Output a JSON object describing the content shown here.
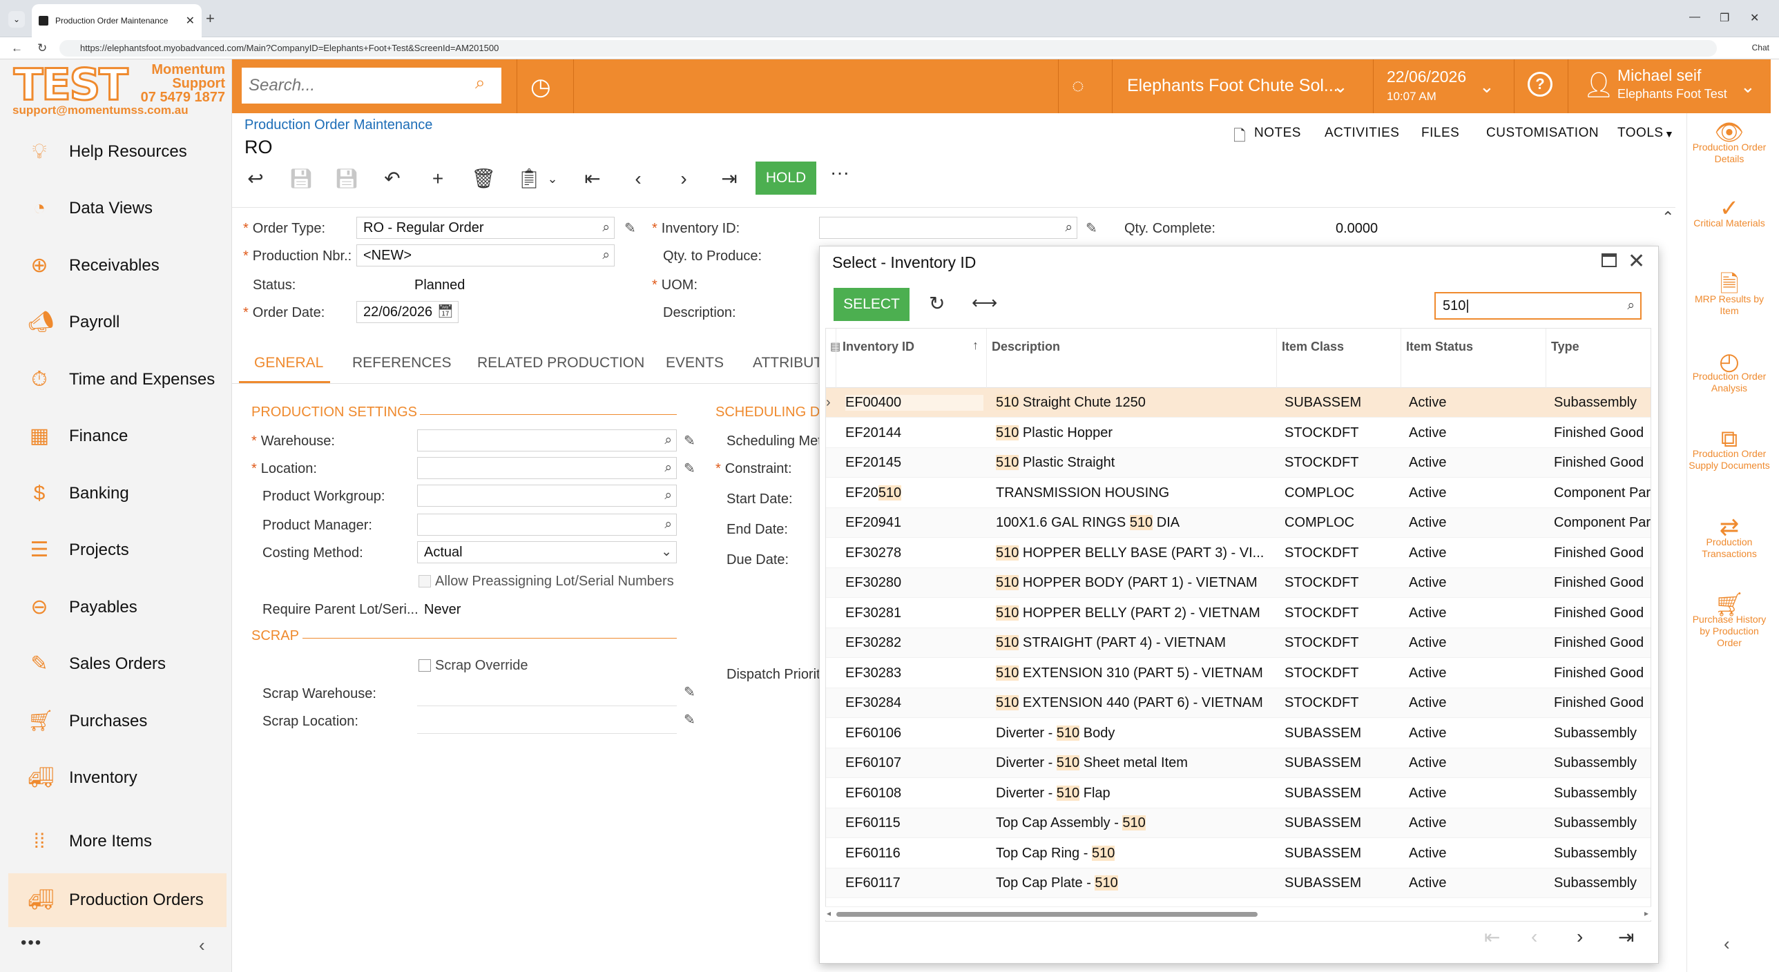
{
  "browser": {
    "tab_title": "Production Order Maintenance",
    "url": "https://elephantsfoot.myobadvanced.com/Main?CompanyID=Elephants+Foot+Test&ScreenId=AM201500",
    "chat_label": "Chat"
  },
  "logo": {
    "brand": "TEST",
    "line1": "Momentum",
    "line2": "Support",
    "line3": "07 5479 1877",
    "line4": "support@momentumss.com.au"
  },
  "sidebar": {
    "items": [
      {
        "label": "Help Resources",
        "icon": "lightbulb-icon"
      },
      {
        "label": "Data Views",
        "icon": "pie-chart-icon"
      },
      {
        "label": "Receivables",
        "icon": "plus-circle-icon"
      },
      {
        "label": "Payroll",
        "icon": "megaphone-icon"
      },
      {
        "label": "Time and Expenses",
        "icon": "stopwatch-icon"
      },
      {
        "label": "Finance",
        "icon": "calculator-icon"
      },
      {
        "label": "Banking",
        "icon": "dollar-icon"
      },
      {
        "label": "Projects",
        "icon": "projects-icon"
      },
      {
        "label": "Payables",
        "icon": "minus-circle-icon"
      },
      {
        "label": "Sales Orders",
        "icon": "edit-icon"
      },
      {
        "label": "Purchases",
        "icon": "cart-icon"
      },
      {
        "label": "Inventory",
        "icon": "truck-icon"
      },
      {
        "label": "More Items",
        "icon": "grid-dots-icon"
      },
      {
        "label": "Production Orders",
        "icon": "truck-icon"
      }
    ],
    "more": "•••"
  },
  "topbar": {
    "search_placeholder": "Search...",
    "company": "Elephants Foot Chute Sol...",
    "date": "22/06/2026",
    "time": "10:07 AM",
    "user_name": "Michael seif",
    "user_company": "Elephants Foot Test"
  },
  "page": {
    "breadcrumb": "Production Order Maintenance",
    "title": "RO",
    "hold_label": "HOLD",
    "more": "···",
    "links": {
      "notes": "NOTES",
      "activities": "ACTIVITIES",
      "files": "FILES",
      "customisation": "CUSTOMISATION",
      "tools": "TOOLS"
    }
  },
  "form": {
    "order_type_label": "Order Type:",
    "order_type": "RO - Regular Order",
    "production_nbr_label": "Production Nbr.:",
    "production_nbr": "<NEW>",
    "status_label": "Status:",
    "status": "Planned",
    "order_date_label": "Order Date:",
    "order_date": "22/06/2026",
    "inventory_id_label": "Inventory ID:",
    "qty_to_produce_label": "Qty. to Produce:",
    "uom_label": "UOM:",
    "description_label": "Description:",
    "qty_complete_label": "Qty. Complete:",
    "qty_complete": "0.0000"
  },
  "tabs": [
    "GENERAL",
    "REFERENCES",
    "RELATED PRODUCTION",
    "EVENTS",
    "ATTRIBUT"
  ],
  "general": {
    "production_settings": "PRODUCTION SETTINGS",
    "warehouse_label": "Warehouse:",
    "location_label": "Location:",
    "product_workgroup_label": "Product Workgroup:",
    "product_manager_label": "Product Manager:",
    "costing_method_label": "Costing Method:",
    "costing_method": "Actual",
    "allow_preassign_label": "Allow Preassigning Lot/Serial Numbers",
    "require_parent_label": "Require Parent Lot/Seri...",
    "require_parent": "Never",
    "scrap": "SCRAP",
    "scrap_override_label": "Scrap Override",
    "scrap_warehouse_label": "Scrap Warehouse:",
    "scrap_location_label": "Scrap Location:",
    "scheduling": "SCHEDULING D",
    "scheduling_method_label": "Scheduling Met",
    "constraint_label": "Constraint:",
    "start_date_label": "Start Date:",
    "end_date_label": "End Date:",
    "due_date_label": "Due Date:",
    "dispatch_priority_label": "Dispatch Priorit"
  },
  "right_panel": [
    {
      "label": "Production Order Details",
      "icon": "eye-icon"
    },
    {
      "label": "Critical Materials",
      "icon": "check-circle-icon"
    },
    {
      "label": "MRP Results by Item",
      "icon": "document-icon"
    },
    {
      "label": "Production Order Analysis",
      "icon": "gauge-icon"
    },
    {
      "label": "Production Order Supply Documents",
      "icon": "hierarchy-icon"
    },
    {
      "label": "Production Transactions",
      "icon": "swap-arrows-icon"
    },
    {
      "label": "Purchase History by Production Order",
      "icon": "cart-icon"
    }
  ],
  "dialog": {
    "title": "Select - Inventory ID",
    "select_label": "SELECT",
    "search_value": "510",
    "columns": [
      "Inventory ID",
      "Description",
      "Item Class",
      "Item Status",
      "Type"
    ],
    "rows": [
      {
        "id": "EF00400",
        "desc": "510 Straight Chute 1250",
        "cls": "SUBASSEM",
        "status": "Active",
        "type": "Subassembly"
      },
      {
        "id": "EF20144",
        "desc": "510 Plastic Hopper",
        "cls": "STOCKDFT",
        "status": "Active",
        "type": "Finished Good"
      },
      {
        "id": "EF20145",
        "desc": "510 Plastic Straight",
        "cls": "STOCKDFT",
        "status": "Active",
        "type": "Finished Good"
      },
      {
        "id": "EF20510",
        "desc": "TRANSMISSION HOUSING",
        "cls": "COMPLOC",
        "status": "Active",
        "type": "Component Part"
      },
      {
        "id": "EF20941",
        "desc": "100X1.6 GAL RINGS 510 DIA",
        "cls": "COMPLOC",
        "status": "Active",
        "type": "Component Part"
      },
      {
        "id": "EF30278",
        "desc": "510 HOPPER BELLY BASE (PART 3) - VI...",
        "cls": "STOCKDFT",
        "status": "Active",
        "type": "Finished Good"
      },
      {
        "id": "EF30280",
        "desc": "510 HOPPER BODY (PART 1) - VIETNAM",
        "cls": "STOCKDFT",
        "status": "Active",
        "type": "Finished Good"
      },
      {
        "id": "EF30281",
        "desc": "510 HOPPER BELLY (PART 2) - VIETNAM",
        "cls": "STOCKDFT",
        "status": "Active",
        "type": "Finished Good"
      },
      {
        "id": "EF30282",
        "desc": "510 STRAIGHT (PART 4) - VIETNAM",
        "cls": "STOCKDFT",
        "status": "Active",
        "type": "Finished Good"
      },
      {
        "id": "EF30283",
        "desc": "510 EXTENSION 310 (PART 5) - VIETNAM",
        "cls": "STOCKDFT",
        "status": "Active",
        "type": "Finished Good"
      },
      {
        "id": "EF30284",
        "desc": "510 EXTENSION 440 (PART 6) - VIETNAM",
        "cls": "STOCKDFT",
        "status": "Active",
        "type": "Finished Good"
      },
      {
        "id": "EF60106",
        "desc": "Diverter - 510 Body",
        "cls": "SUBASSEM",
        "status": "Active",
        "type": "Subassembly"
      },
      {
        "id": "EF60107",
        "desc": "Diverter - 510 Sheet metal Item",
        "cls": "SUBASSEM",
        "status": "Active",
        "type": "Subassembly"
      },
      {
        "id": "EF60108",
        "desc": "Diverter - 510 Flap",
        "cls": "SUBASSEM",
        "status": "Active",
        "type": "Subassembly"
      },
      {
        "id": "EF60115",
        "desc": "Top Cap Assembly - 510",
        "cls": "SUBASSEM",
        "status": "Active",
        "type": "Subassembly"
      },
      {
        "id": "EF60116",
        "desc": "Top Cap Ring - 510",
        "cls": "SUBASSEM",
        "status": "Active",
        "type": "Subassembly"
      },
      {
        "id": "EF60117",
        "desc": "Top Cap Plate - 510",
        "cls": "SUBASSEM",
        "status": "Active",
        "type": "Subassembly"
      }
    ]
  },
  "colors": {
    "accent": "#ef8a2e",
    "green": "#4caf50",
    "link": "#1c6db7",
    "highlight": "#fde5c6"
  }
}
